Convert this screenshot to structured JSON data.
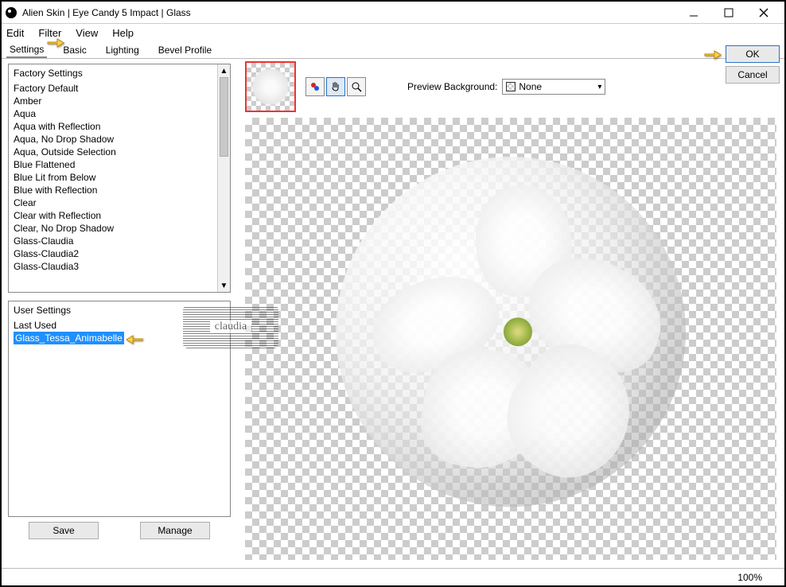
{
  "window": {
    "title": "Alien Skin | Eye Candy 5 Impact | Glass"
  },
  "menubar": {
    "items": [
      "Edit",
      "Filter",
      "View",
      "Help"
    ]
  },
  "tabs": {
    "items": [
      "Settings",
      "Basic",
      "Lighting",
      "Bevel Profile"
    ],
    "active": 0
  },
  "factory_settings": {
    "header": "Factory Settings",
    "items": [
      "Factory Default",
      "Amber",
      "Aqua",
      "Aqua with Reflection",
      "Aqua, No Drop Shadow",
      "Aqua, Outside Selection",
      "Blue Flattened",
      "Blue Lit from Below",
      "Blue with Reflection",
      "Clear",
      "Clear with Reflection",
      "Clear, No Drop Shadow",
      "Glass-Claudia",
      "Glass-Claudia2",
      "Glass-Claudia3"
    ]
  },
  "user_settings": {
    "header": "User Settings",
    "items": [
      {
        "label": "Last Used",
        "selected": false
      },
      {
        "label": "Glass_Tessa_Animabelle",
        "selected": true
      }
    ]
  },
  "buttons": {
    "save": "Save",
    "manage": "Manage",
    "ok": "OK",
    "cancel": "Cancel"
  },
  "preview": {
    "bg_label": "Preview Background:",
    "bg_value": "None"
  },
  "statusbar": {
    "zoom": "100%"
  },
  "watermark": "claudia"
}
